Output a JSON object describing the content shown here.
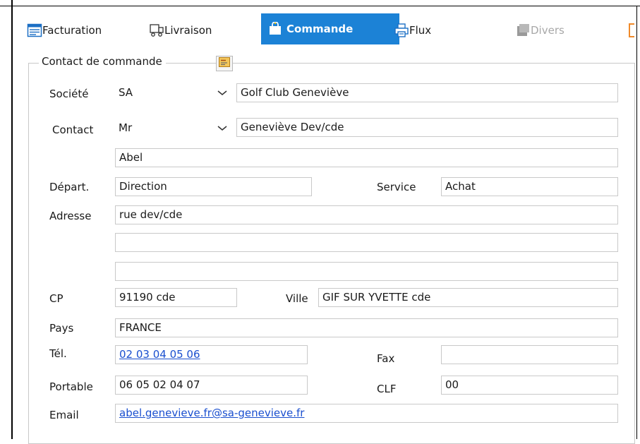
{
  "tabs": [
    {
      "label": "Facturation",
      "icon": "invoice-icon",
      "state": "normal"
    },
    {
      "label": "Livraison",
      "icon": "delivery-icon",
      "state": "normal"
    },
    {
      "label": "Commande",
      "icon": "order-bag-icon",
      "state": "active"
    },
    {
      "label": "Flux",
      "icon": "printer-icon",
      "state": "normal"
    },
    {
      "label": "Divers",
      "icon": "misc-icon",
      "state": "disabled"
    }
  ],
  "group": {
    "title": "Contact de commande",
    "title_button_icon": "contact-card-icon"
  },
  "form": {
    "societe": {
      "label": "Société",
      "type_value": "SA",
      "name_value": "Golf Club Geneviève"
    },
    "contact": {
      "label": "Contact",
      "civility_value": "Mr",
      "name_value": "Geneviève Dev/cde",
      "firstname_value": "Abel"
    },
    "depart": {
      "label": "Départ.",
      "value": "Direction"
    },
    "service": {
      "label": "Service",
      "value": "Achat"
    },
    "adresse": {
      "label": "Adresse",
      "line1": "rue dev/cde",
      "line2": "",
      "line3": ""
    },
    "cp": {
      "label": "CP",
      "value": "91190 cde"
    },
    "ville": {
      "label": "Ville",
      "value": "GIF SUR YVETTE cde"
    },
    "pays": {
      "label": "Pays",
      "value": "FRANCE"
    },
    "tel": {
      "label": "Tél.",
      "value": "02 03 04 05 06"
    },
    "fax": {
      "label": "Fax",
      "value": ""
    },
    "portable": {
      "label": "Portable",
      "value": "06 05 02 04 07"
    },
    "clf": {
      "label": "CLF",
      "value": "00"
    },
    "email": {
      "label": "Email",
      "value": "abel.genevieve.fr@sa-genevieve.fr"
    }
  },
  "colors": {
    "active_tab": "#1c82d6",
    "link": "#1a4fcf",
    "disabled": "#a8a8a8",
    "accent_orange": "#f08a2a"
  }
}
